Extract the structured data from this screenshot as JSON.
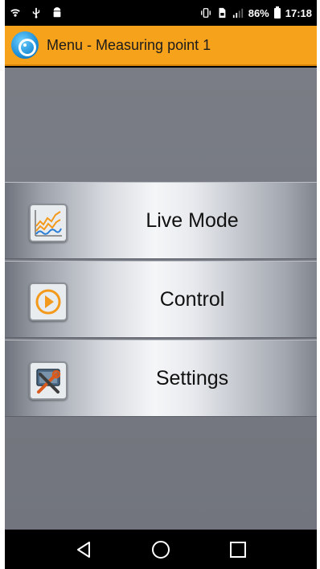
{
  "status_bar": {
    "battery": "86%",
    "time": "17:18"
  },
  "app_bar": {
    "title": "Menu - Measuring point 1"
  },
  "menu": {
    "items": [
      {
        "label": "Live Mode",
        "icon": "line-chart-icon"
      },
      {
        "label": "Control",
        "icon": "play-circle-icon"
      },
      {
        "label": "Settings",
        "icon": "tools-icon"
      }
    ]
  },
  "nav_bar": {
    "buttons": [
      "back-icon",
      "home-icon",
      "recents-icon"
    ]
  },
  "colors": {
    "app_bar": "#f7a21b",
    "content_bg": "#7a7d85",
    "accent_orange": "#f39a1d",
    "chart_blue": "#2c7fd6"
  }
}
